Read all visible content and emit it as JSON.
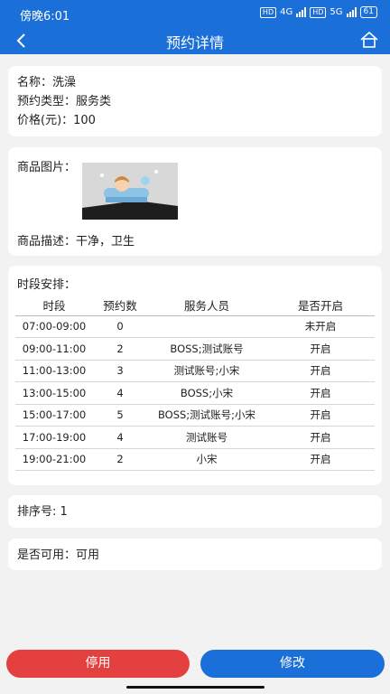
{
  "status_bar": {
    "time": "傍晚6:01",
    "hd1": "HD",
    "net1": "4G",
    "hd2": "HD",
    "net2": "5G",
    "battery": "61"
  },
  "header": {
    "title": "预约详情",
    "back_icon": "chevron-left-icon",
    "home_icon": "home-icon"
  },
  "info": {
    "name": "名称：洗澡",
    "type": "预约类型：服务类",
    "price": "价格(元)：100"
  },
  "product": {
    "image_label": "商品图片：",
    "description": "商品描述：干净，卫生"
  },
  "schedule": {
    "heading": "时段安排：",
    "columns": [
      "时段",
      "预约数",
      "服务人员",
      "是否开启"
    ],
    "rows": [
      [
        "07:00-09:00",
        "0",
        "",
        "未开启"
      ],
      [
        "09:00-11:00",
        "2",
        "BOSS;测试账号",
        "开启"
      ],
      [
        "11:00-13:00",
        "3",
        "测试账号;小宋",
        "开启"
      ],
      [
        "13:00-15:00",
        "4",
        "BOSS;小宋",
        "开启"
      ],
      [
        "15:00-17:00",
        "5",
        "BOSS;测试账号;小宋",
        "开启"
      ],
      [
        "17:00-19:00",
        "4",
        "测试账号",
        "开启"
      ],
      [
        "19:00-21:00",
        "2",
        "小宋",
        "开启"
      ]
    ]
  },
  "sort": {
    "label": "排序号: 1"
  },
  "available": {
    "label": "是否可用：可用"
  },
  "buttons": {
    "disable": "停用",
    "edit": "修改"
  },
  "colors": {
    "primary": "#1a6fd8",
    "danger": "#e4403f",
    "background": "#f2f2f2"
  }
}
